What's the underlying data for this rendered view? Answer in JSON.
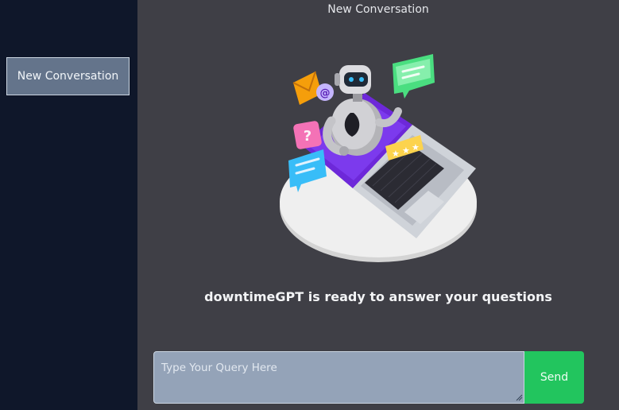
{
  "sidebar": {
    "new_conversation_label": "New Conversation"
  },
  "header": {
    "title": "New Conversation"
  },
  "main": {
    "illustration_icon": "robot-laptop-illustration",
    "ready_message": "downtimeGPT is ready to answer your questions"
  },
  "composer": {
    "placeholder": "Type Your Query Here",
    "value": "",
    "send_label": "Send"
  },
  "colors": {
    "sidebar_bg": "#0f172a",
    "main_bg": "#3f3f46",
    "input_bg": "#94a3b8",
    "send_bg": "#22c55e",
    "button_bg": "#64748b"
  }
}
